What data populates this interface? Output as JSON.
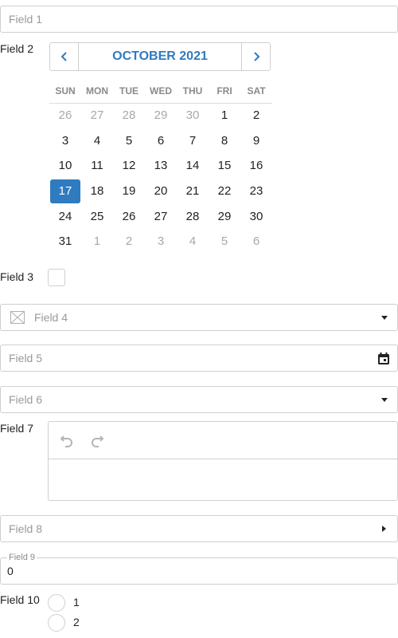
{
  "field1": {
    "placeholder": "Field 1"
  },
  "field2": {
    "label": "Field 2",
    "calendar": {
      "month_title": "OCTOBER 2021",
      "weekdays": [
        "SUN",
        "MON",
        "TUE",
        "WED",
        "THU",
        "FRI",
        "SAT"
      ],
      "weeks": [
        [
          "26",
          "27",
          "28",
          "29",
          "30",
          "1",
          "2"
        ],
        [
          "3",
          "4",
          "5",
          "6",
          "7",
          "8",
          "9"
        ],
        [
          "10",
          "11",
          "12",
          "13",
          "14",
          "15",
          "16"
        ],
        [
          "17",
          "18",
          "19",
          "20",
          "21",
          "22",
          "23"
        ],
        [
          "24",
          "25",
          "26",
          "27",
          "28",
          "29",
          "30"
        ],
        [
          "31",
          "1",
          "2",
          "3",
          "4",
          "5",
          "6"
        ]
      ],
      "selected_day": "17",
      "accent_color": "#2f7bbf"
    }
  },
  "field3": {
    "label": "Field 3",
    "checked": false
  },
  "field4": {
    "placeholder": "Field 4",
    "icon": "image-placeholder-icon"
  },
  "field5": {
    "placeholder": "Field 5",
    "icon": "calendar-icon"
  },
  "field6": {
    "placeholder": "Field 6"
  },
  "field7": {
    "label": "Field 7",
    "toolbar": [
      "undo-icon",
      "redo-icon"
    ]
  },
  "field8": {
    "placeholder": "Field 8"
  },
  "field9": {
    "legend": "Field 9",
    "value": "0"
  },
  "field10": {
    "label": "Field 10",
    "options": [
      "1",
      "2"
    ]
  }
}
